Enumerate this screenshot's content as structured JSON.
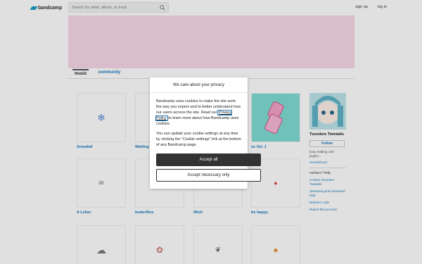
{
  "header": {
    "logo_text": "bandcamp",
    "search_placeholder": "Search for artist, album, or track",
    "signup": "sign up",
    "login": "log in"
  },
  "tabs": [
    {
      "label": "music",
      "active": true
    },
    {
      "label": "community",
      "active": false
    }
  ],
  "grid": {
    "items": [
      {
        "title": "Snowfall",
        "icon": "snowflake-icon",
        "glyph": "❄"
      },
      {
        "title": "Waiting",
        "icon": "blank",
        "glyph": ""
      },
      {
        "title": "",
        "icon": "blank",
        "glyph": ""
      },
      {
        "title": "es Vol. 1",
        "icon": "flip-phone-icon",
        "glyph": ""
      },
      {
        "title": "A Letter",
        "icon": "envelope-icon",
        "glyph": "✉"
      },
      {
        "title": "butterflies",
        "icon": "butterfly-icon",
        "glyph": ""
      },
      {
        "title": "Wish",
        "icon": "wish-icon",
        "glyph": ""
      },
      {
        "title": "be happy",
        "icon": "balloon-icon",
        "glyph": "🎈"
      },
      {
        "title": "",
        "icon": "cloud-icon",
        "glyph": "☁"
      },
      {
        "title": "",
        "icon": "bunny-icon",
        "glyph": "🐰"
      },
      {
        "title": "",
        "icon": "leaves-icon",
        "glyph": "🍃"
      },
      {
        "title": "",
        "icon": "cat-icon",
        "glyph": "🐱"
      }
    ]
  },
  "sidebar": {
    "artist_name": "Tsundere Twintails",
    "follow_label": "Follow",
    "bio": "busy making cute jingles...",
    "soundcloud": "SoundCloud",
    "contact_heading": "contact / help",
    "links": [
      "Contact Tsundere Twintails",
      "Streaming and Download help",
      "Redeem code",
      "Report this account"
    ]
  },
  "modal": {
    "title": "We care about your privacy",
    "para1_before": "Bandcamp uses cookies to make the site work the way you expect and to better understand how our users access the site. Read our ",
    "policy_link": "Privacy Policy",
    "para1_after": " to learn more about how Bandcamp uses cookies.",
    "para2": "You can update your cookie settings at any time by clicking the \"Cookie settings\" link at the bottom of any Bandcamp page.",
    "accept_all": "Accept all",
    "accept_necessary": "Accept necessary only"
  },
  "colors": {
    "banner": "#f8d8e6",
    "link": "#1d7cbf",
    "brand": "#1da0c3",
    "primary_button": "#333333"
  }
}
